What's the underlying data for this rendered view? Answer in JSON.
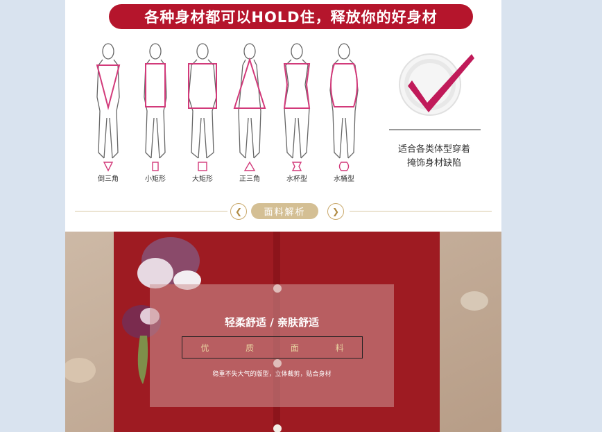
{
  "banner": {
    "title": "各种身材都可以HOLD住，释放你的好身材"
  },
  "body_types": [
    {
      "label": "倒三角"
    },
    {
      "label": "小矩形"
    },
    {
      "label": "大矩形"
    },
    {
      "label": "正三角"
    },
    {
      "label": "水杯型"
    },
    {
      "label": "水桶型"
    }
  ],
  "badge": {
    "line1": "适合各类体型穿着",
    "line2": "掩饰身材缺陷"
  },
  "section": {
    "title": "面料解析",
    "prev_icon": "chevron-left-icon",
    "next_icon": "chevron-right-icon"
  },
  "fabric": {
    "title": "轻柔舒适 / 亲肤舒适",
    "box_chars": [
      "优",
      "质",
      "面",
      "料"
    ],
    "subtitle": "稳重不失大气的版型，立体裁剪，贴合身材"
  },
  "colors": {
    "accent": "#b5152c",
    "gold": "#d4bf94",
    "outline": "#d23a7a"
  }
}
